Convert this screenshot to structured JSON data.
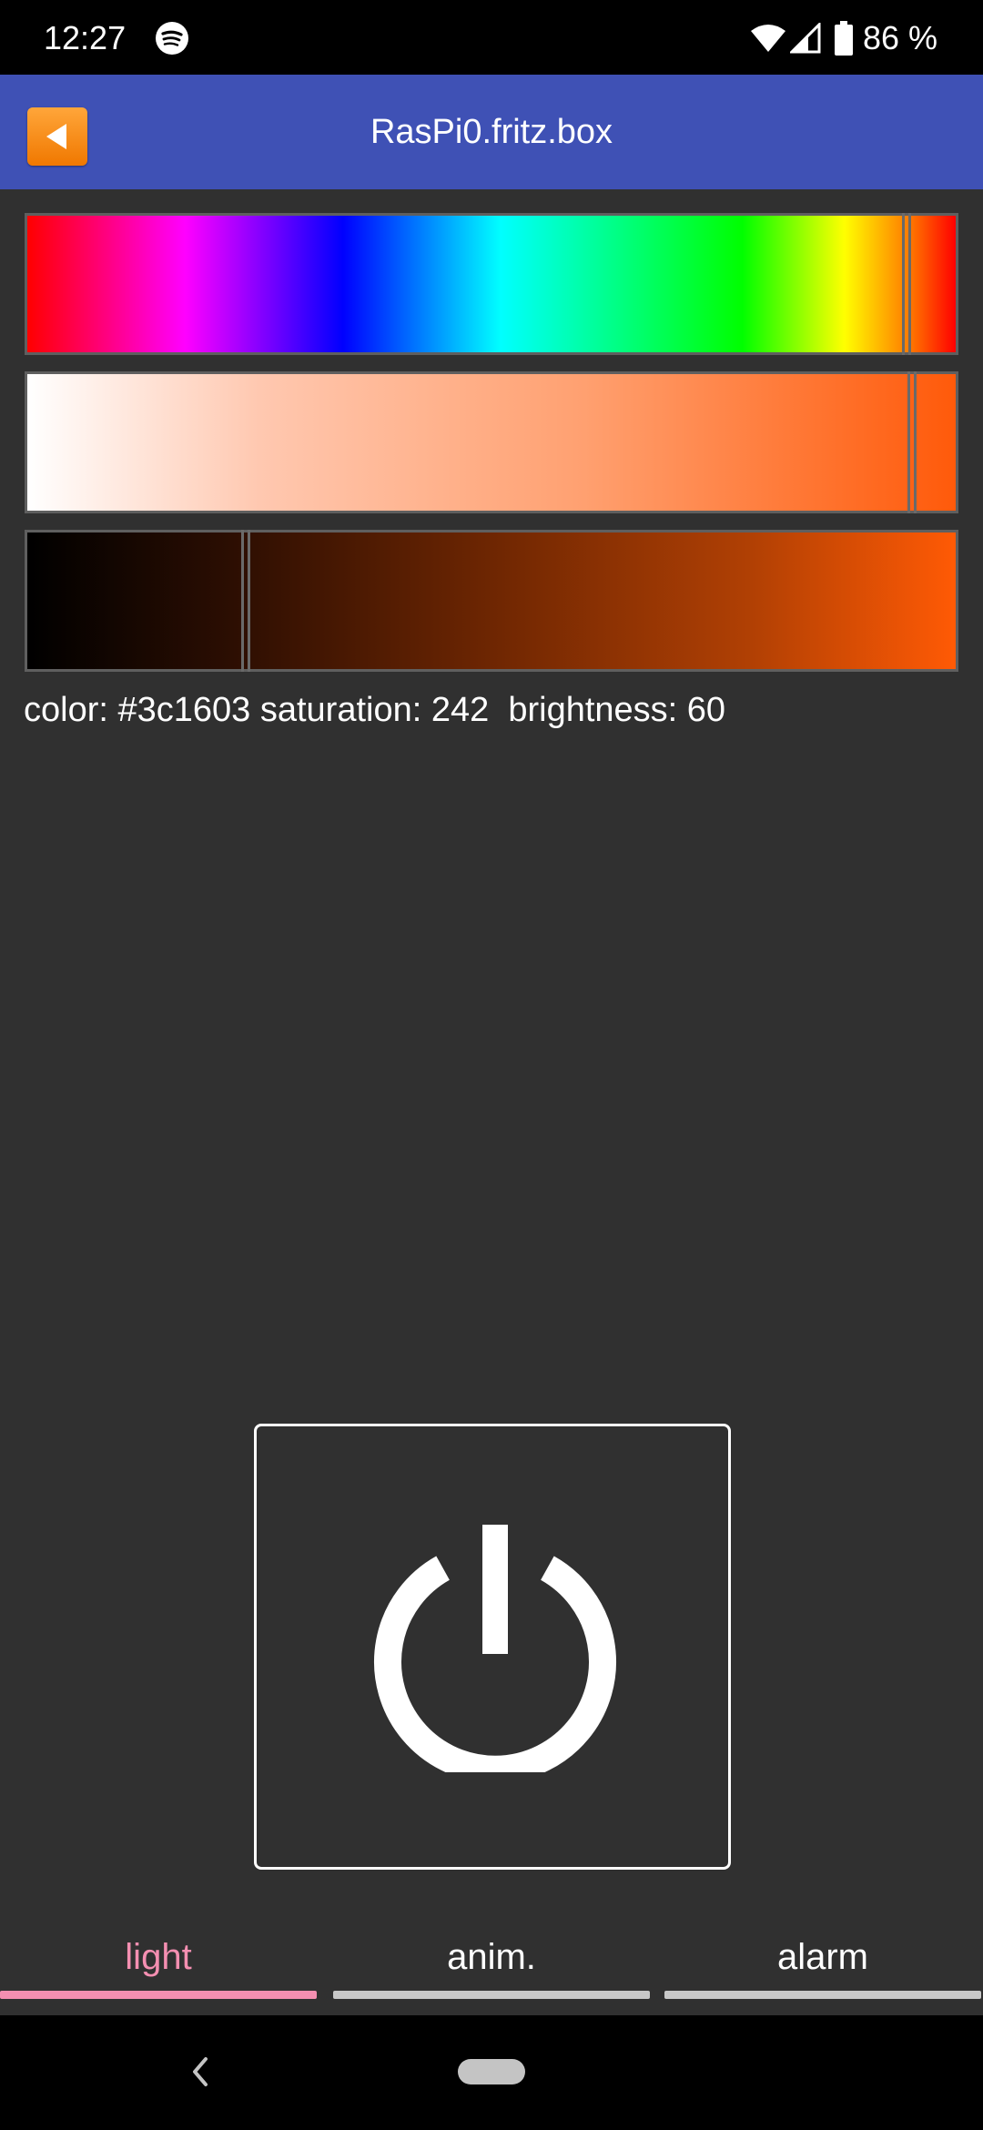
{
  "status_bar": {
    "time": "12:27",
    "battery_percent": "86 %",
    "icons": [
      "spotify-icon",
      "wifi-icon",
      "cell-signal-icon",
      "battery-icon"
    ]
  },
  "app_bar": {
    "title": "RasPi0.fritz.box",
    "back_icon": "back-arrow-icon",
    "back_color": "#f78a12"
  },
  "sliders": {
    "hue_position": 0.945,
    "saturation_position": 0.95,
    "brightness_position": 0.235
  },
  "info": {
    "text": "color: #3c1603 saturation: 242  brightness: 60",
    "color": "#3c1603",
    "saturation": 242,
    "brightness": 60
  },
  "power": {
    "icon": "power-icon"
  },
  "tabs": [
    {
      "label": "light",
      "active": true
    },
    {
      "label": "anim.",
      "active": false
    },
    {
      "label": "alarm",
      "active": false
    }
  ],
  "colors": {
    "background": "#303030",
    "app_bar": "#3f51b5",
    "active_tab": "#f48fb1",
    "inactive_tab_indicator": "#c8c8c8"
  },
  "nav_bar": {
    "icons": [
      "back-chevron-icon",
      "home-pill-icon"
    ]
  }
}
